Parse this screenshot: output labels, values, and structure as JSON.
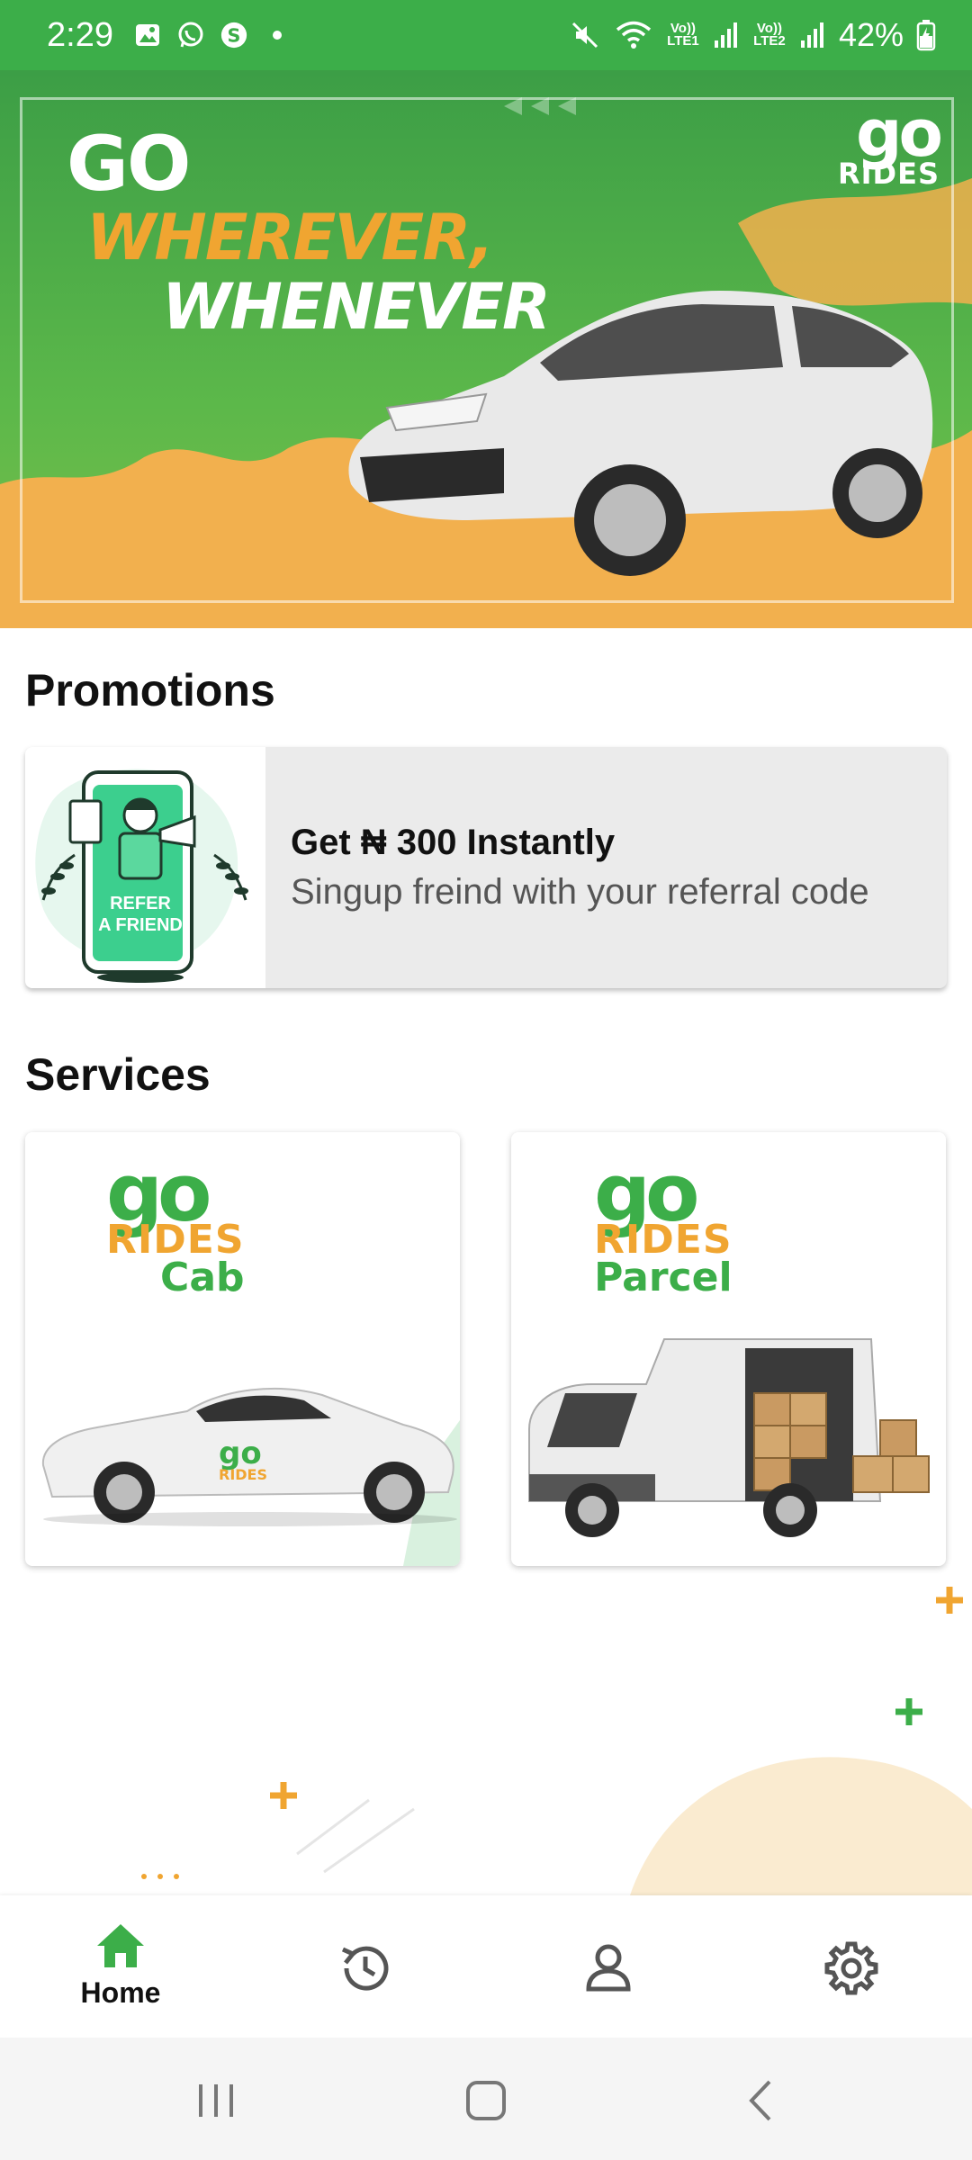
{
  "status_bar": {
    "time": "2:29",
    "network1": "Vo)) LTE1",
    "network2": "Vo)) LTE2",
    "battery": "42%",
    "icons": [
      "gallery-icon",
      "whatsapp-icon",
      "s-app-icon",
      "dot-icon",
      "mute-icon",
      "wifi-icon",
      "signal-icon",
      "battery-icon"
    ]
  },
  "banner": {
    "line1": "GO",
    "line2": "WHEREVER,",
    "line3": "WHENEVER",
    "logo_go": "go",
    "logo_rides": "RIDES"
  },
  "promotions": {
    "heading": "Promotions",
    "card": {
      "title": "Get ₦ 300 Instantly",
      "subtitle": "Singup freind with your referral code",
      "image_text": "REFER A FRIEND"
    }
  },
  "services": {
    "heading": "Services",
    "items": [
      {
        "go": "go",
        "rides": "RIDES",
        "sub": "Cab"
      },
      {
        "go": "go",
        "rides": "RIDES",
        "sub": "Parcel"
      }
    ]
  },
  "bottom_nav": {
    "home_label": "Home",
    "items": [
      "home-icon",
      "history-icon",
      "profile-icon",
      "settings-icon"
    ]
  },
  "colors": {
    "brand_green": "#3cae49",
    "brand_orange": "#f0a531"
  }
}
